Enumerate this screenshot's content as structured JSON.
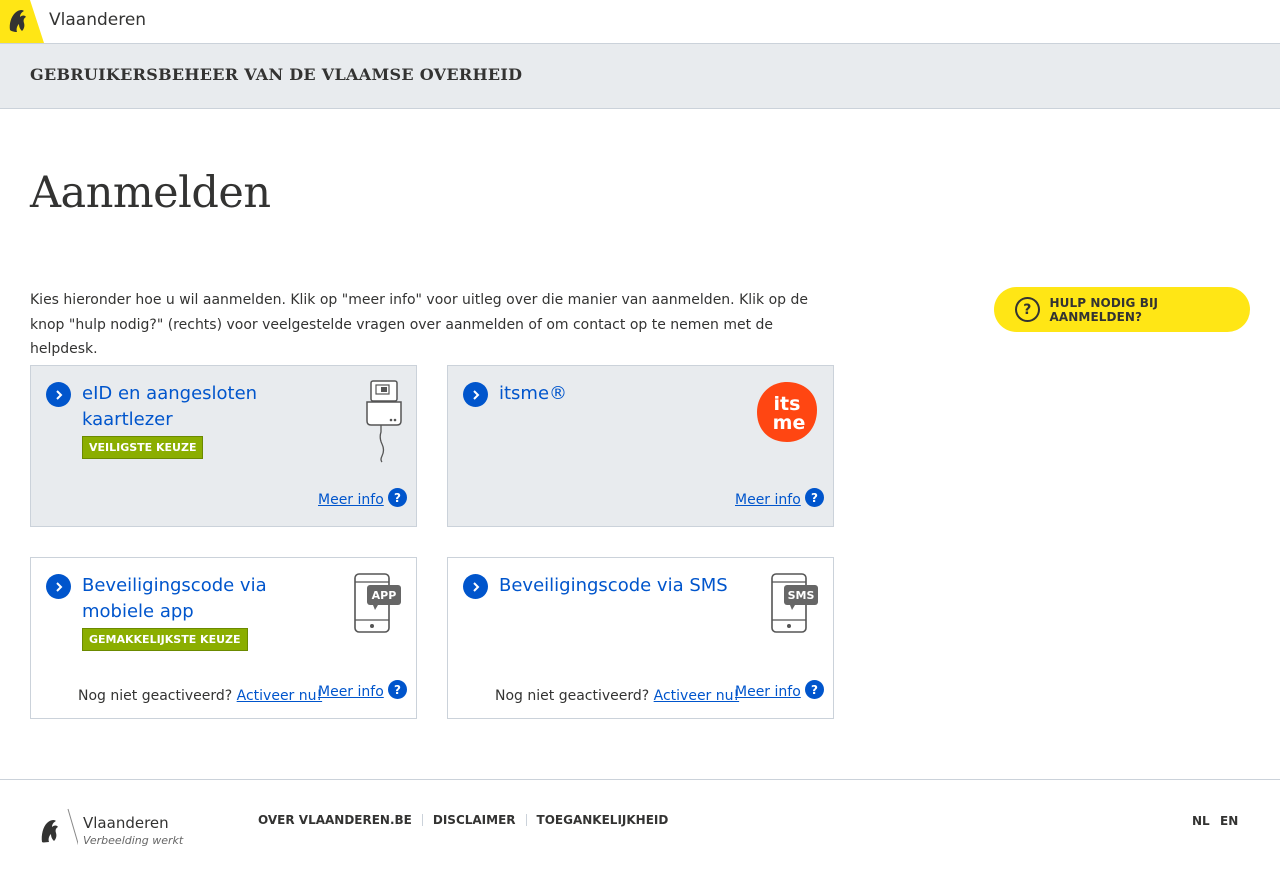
{
  "header": {
    "brand": "Vlaanderen"
  },
  "subheader": {
    "title": "GEBRUIKERSBEHEER VAN DE VLAAMSE OVERHEID"
  },
  "page": {
    "title": "Aanmelden",
    "intro": "Kies hieronder hoe u wil aanmelden. Klik op \"meer info\" voor uitleg over die manier van aanmelden. Klik op de knop \"hulp nodig?\" (rechts) voor veelgestelde vragen over aanmelden of om contact op te nemen met de helpdesk."
  },
  "help": {
    "icon": "?",
    "label": "HULP NODIG BIJ AANMELDEN?"
  },
  "cards": [
    {
      "title": "eID en aangesloten kaartlezer",
      "badge": "VEILIGSTE KEUZE",
      "more": "Meer info",
      "icon": "card-reader-icon"
    },
    {
      "title": "itsme®",
      "more": "Meer info",
      "icon": "itsme-logo"
    },
    {
      "title": "Beveiligingscode via mobiele app",
      "badge": "GEMAKKELIJKSTE KEUZE",
      "more": "Meer info",
      "activate_text": "Nog niet geactiveerd? ",
      "activate_link": "Activeer nu!",
      "icon": "phone-app-icon",
      "icon_label": "APP"
    },
    {
      "title": "Beveiligingscode via SMS",
      "more": "Meer info",
      "activate_text": "Nog niet geactiveerd? ",
      "activate_link": "Activeer nu!",
      "icon": "phone-sms-icon",
      "icon_label": "SMS"
    }
  ],
  "footer": {
    "brand": "Vlaanderen",
    "tagline": "Verbeelding werkt",
    "links": [
      "OVER VLAANDEREN.BE",
      "DISCLAIMER",
      "TOEGANKELIJKHEID"
    ],
    "languages": [
      "NL",
      "EN"
    ]
  },
  "logo_itsme": {
    "line1": "its",
    "line2": "me"
  },
  "colors": {
    "accent": "#0055cc",
    "yellow": "#ffe615",
    "badge_green": "#8bae00",
    "itsme": "#ff4612"
  }
}
